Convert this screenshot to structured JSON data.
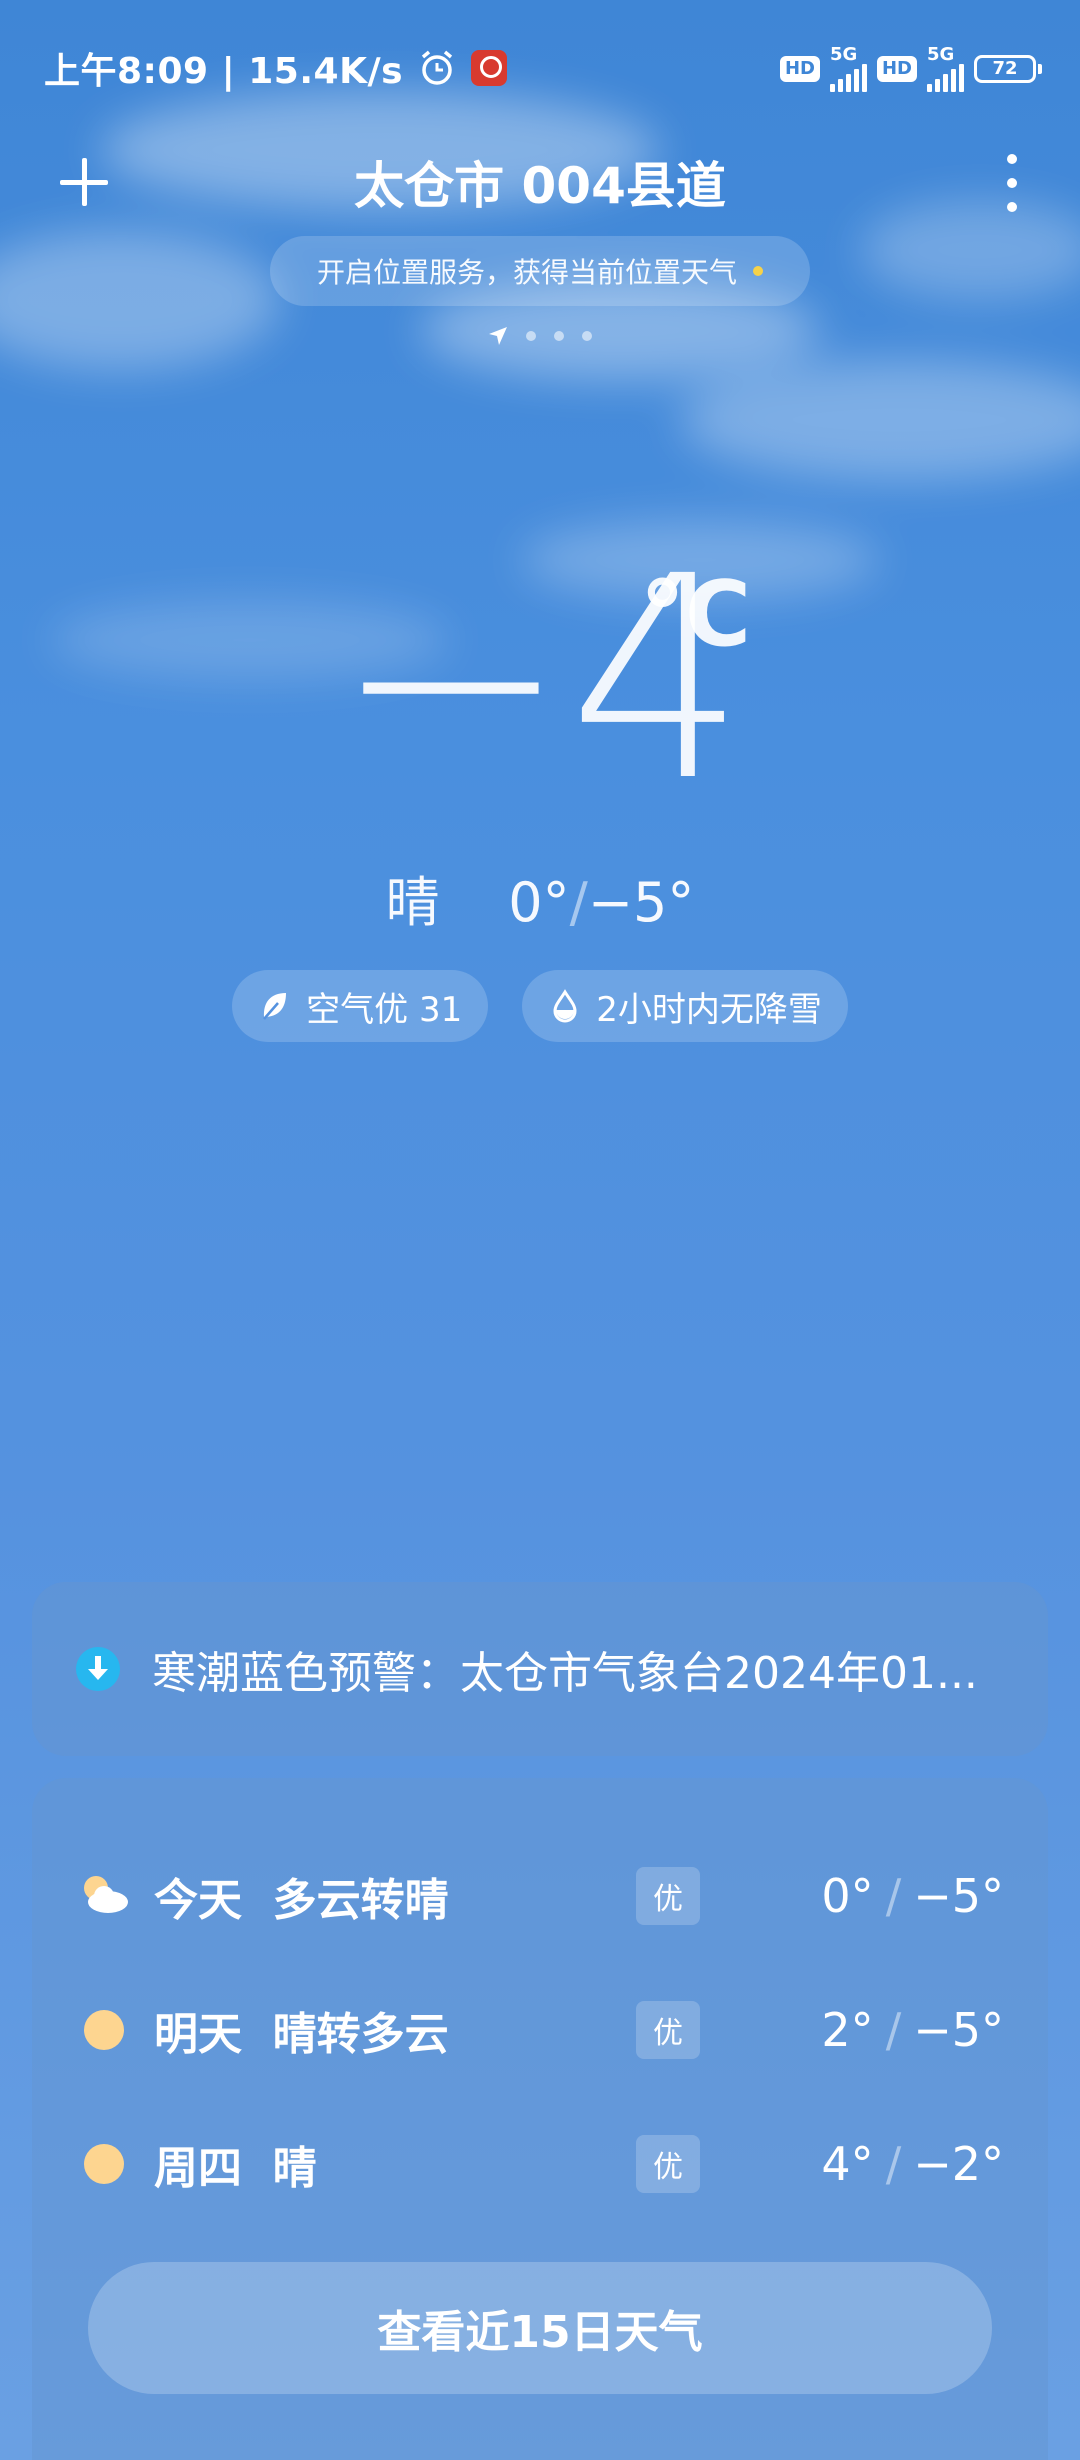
{
  "status_bar": {
    "time_speed": "上午8:09 | 15.4K/s",
    "hd1": "HD",
    "net1": "5G",
    "hd2": "HD",
    "net2": "5G",
    "battery": "72"
  },
  "header": {
    "title": "太仓市 004县道",
    "location_prompt": "开启位置服务，获得当前位置天气"
  },
  "current": {
    "temperature": "−4",
    "unit": "°C",
    "condition": "晴",
    "high": "0°",
    "low": "−5°",
    "chips": {
      "air": "空气优 31",
      "precip": "2小时内无降雪"
    }
  },
  "alert": {
    "text": "寒潮蓝色预警：太仓市气象台2024年01..."
  },
  "forecast": [
    {
      "day": "今天",
      "condition": "多云转晴",
      "aqi": "优",
      "high": "0°",
      "low": "−5°",
      "icon": "partly-cloudy-icon"
    },
    {
      "day": "明天",
      "condition": "晴转多云",
      "aqi": "优",
      "high": "2°",
      "low": "−5°",
      "icon": "sun-icon"
    },
    {
      "day": "周四",
      "condition": "晴",
      "aqi": "优",
      "high": "4°",
      "low": "−2°",
      "icon": "sun-icon"
    }
  ],
  "more_button": "查看近15日天气",
  "colors": {
    "background": "#4a8fde",
    "alert_icon": "#27b7ef",
    "sun": "#fdd590",
    "location_dot": "#f6d24a"
  }
}
